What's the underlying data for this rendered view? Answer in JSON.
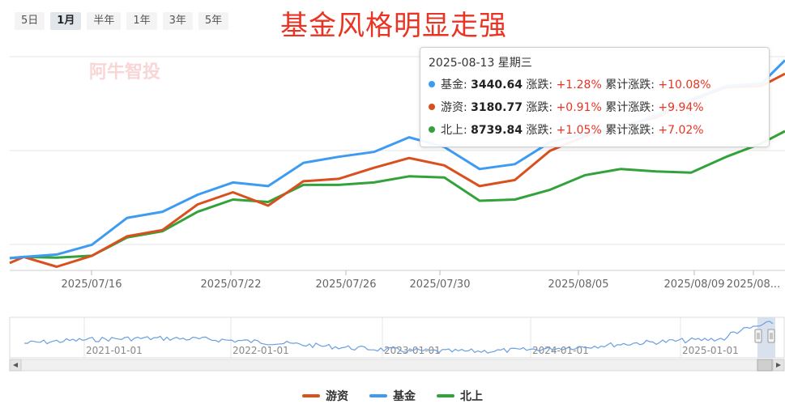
{
  "range_tabs": [
    "5日",
    "1月",
    "半年",
    "1年",
    "3年",
    "5年"
  ],
  "active_range": "1月",
  "headline": "基金风格明显走强",
  "watermark": "阿牛智投",
  "tooltip": {
    "date": "2025-08-13 星期三",
    "rows": [
      {
        "name": "基金",
        "value": "3440.64",
        "chg_label": "涨跌:",
        "chg": "+1.28%",
        "cum_label": "累计涨跌:",
        "cum": "+10.08%",
        "color": "#3e9bf2"
      },
      {
        "name": "游资",
        "value": "3180.77",
        "chg_label": "涨跌:",
        "chg": "+0.91%",
        "cum_label": "累计涨跌:",
        "cum": "+9.94%",
        "color": "#d9501e"
      },
      {
        "name": "北上",
        "value": "8739.84",
        "chg_label": "涨跌:",
        "chg": "+1.05%",
        "cum_label": "累计涨跌:",
        "cum": "+7.02%",
        "color": "#34a23a"
      }
    ]
  },
  "chart_data": {
    "type": "line",
    "x_ticks": [
      "2025/07/16",
      "2025/07/22",
      "2025/07/26",
      "2025/07/30",
      "2025/08/05",
      "2025/08/09",
      "2025/08..."
    ],
    "ylim": [
      -1,
      10.5
    ],
    "grid": true,
    "y_unit": "cumulative % change",
    "series": [
      {
        "name": "游资",
        "color": "#d9501e",
        "points": [
          [
            0,
            -0.4
          ],
          [
            0.6,
            0.1
          ],
          [
            2,
            -0.7
          ],
          [
            3.5,
            0.2
          ],
          [
            5,
            1.8
          ],
          [
            6.5,
            2.3
          ],
          [
            8,
            4.4
          ],
          [
            9.5,
            5.4
          ],
          [
            11,
            4.3
          ],
          [
            12.5,
            6.3
          ],
          [
            14,
            6.5
          ],
          [
            15.5,
            7.4
          ],
          [
            17,
            8.2
          ],
          [
            18.5,
            7.6
          ],
          [
            20,
            5.9
          ],
          [
            21.5,
            6.4
          ],
          [
            23,
            8.8
          ],
          [
            24.5,
            10.0
          ],
          [
            26,
            10.8
          ],
          [
            27.5,
            11.5
          ],
          [
            29,
            12.9
          ],
          [
            30.5,
            14.0
          ],
          [
            32,
            14.1
          ],
          [
            33,
            15.1
          ]
        ]
      },
      {
        "name": "基金",
        "color": "#3e9bf2",
        "points": [
          [
            0,
            0
          ],
          [
            0.6,
            0.1
          ],
          [
            2,
            0.3
          ],
          [
            3.5,
            1.1
          ],
          [
            5,
            3.3
          ],
          [
            6.5,
            3.8
          ],
          [
            8,
            5.2
          ],
          [
            9.5,
            6.2
          ],
          [
            11,
            5.9
          ],
          [
            12.5,
            7.8
          ],
          [
            14,
            8.3
          ],
          [
            15.5,
            8.7
          ],
          [
            17,
            9.9
          ],
          [
            18.5,
            9.1
          ],
          [
            20,
            7.3
          ],
          [
            21.5,
            7.7
          ],
          [
            23,
            9.5
          ],
          [
            24.5,
            10.2
          ],
          [
            26,
            10.6
          ],
          [
            27.5,
            11.7
          ],
          [
            29,
            13.0
          ],
          [
            30.5,
            14.1
          ],
          [
            32,
            14.3
          ],
          [
            33,
            16.2
          ]
        ]
      },
      {
        "name": "北上",
        "color": "#34a23a",
        "points": [
          [
            0,
            0
          ],
          [
            0.6,
            0.1
          ],
          [
            2,
            0.05
          ],
          [
            3.5,
            0.2
          ],
          [
            5,
            1.7
          ],
          [
            6.5,
            2.2
          ],
          [
            8,
            3.8
          ],
          [
            9.5,
            4.8
          ],
          [
            11,
            4.6
          ],
          [
            12.5,
            6.0
          ],
          [
            14,
            6.0
          ],
          [
            15.5,
            6.2
          ],
          [
            17,
            6.7
          ],
          [
            18.5,
            6.6
          ],
          [
            20,
            4.7
          ],
          [
            21.5,
            4.8
          ],
          [
            23,
            5.6
          ],
          [
            24.5,
            6.8
          ],
          [
            26,
            7.3
          ],
          [
            27.5,
            7.1
          ],
          [
            29,
            7.0
          ],
          [
            30.5,
            8.3
          ],
          [
            32,
            9.4
          ],
          [
            33,
            10.4
          ]
        ]
      }
    ],
    "navigator_ticks": [
      "2021-01-01",
      "2022-01-01",
      "2023-01-01",
      "2024-01-01",
      "2025-01-01"
    ],
    "legend": [
      "游资",
      "基金",
      "北上"
    ]
  }
}
